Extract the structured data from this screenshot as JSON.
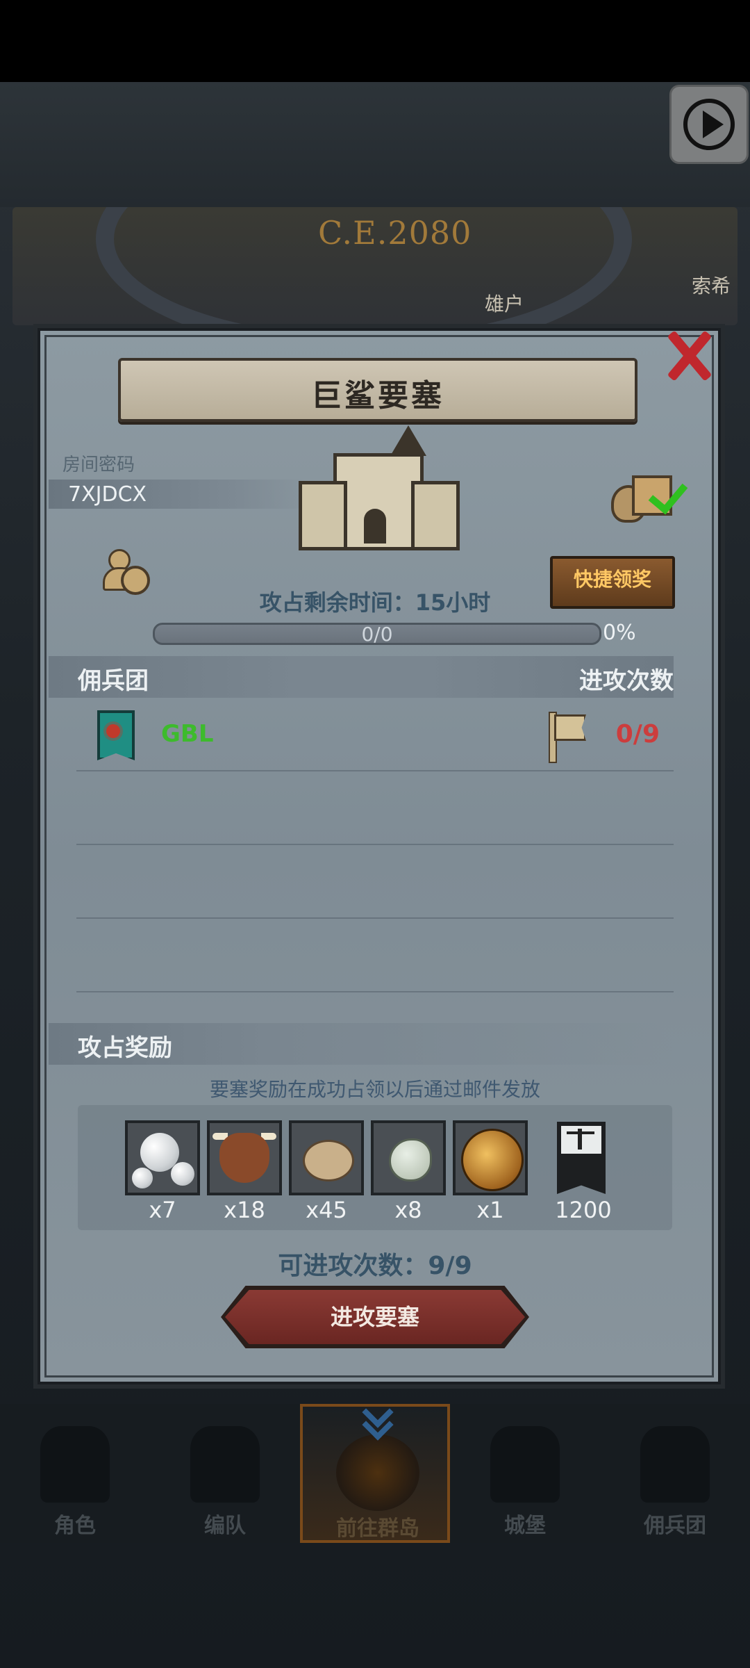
{
  "background": {
    "era_label": "C.E.2080",
    "town_label_1": "雄户",
    "town_label_2": "索希"
  },
  "dialog": {
    "title": "巨鲨要塞",
    "room_code_label": "房间密码",
    "room_code": "7XJDCX",
    "quick_claim_label": "快捷领奖",
    "timer_text": "攻占剩余时间：15小时",
    "progress": {
      "text": "0/0",
      "percent_text": "0%",
      "fraction": 0
    },
    "section_guild": "佣兵团",
    "section_attacks": "进攻次数",
    "guild": {
      "name": "GBL",
      "attacks": "0/9"
    },
    "rewards_title": "攻占奖励",
    "rewards_note": "要塞奖励在成功占领以后通过邮件发放",
    "rewards": [
      {
        "icon": "pearl-icon",
        "qty": "x7"
      },
      {
        "icon": "cow-icon",
        "qty": "x18"
      },
      {
        "icon": "sack-icon",
        "qty": "x45"
      },
      {
        "icon": "stone-icon",
        "qty": "x8"
      },
      {
        "icon": "medal-icon",
        "qty": "x1"
      },
      {
        "icon": "justice-banner-icon",
        "qty": "1200"
      }
    ],
    "remaining_attacks": "可进攻次数：9/9",
    "attack_button": "进攻要塞"
  },
  "nav": [
    {
      "label": "角色",
      "active": false
    },
    {
      "label": "编队",
      "active": false
    },
    {
      "label": "前往群岛",
      "active": true
    },
    {
      "label": "城堡",
      "active": false
    },
    {
      "label": "佣兵团",
      "active": false
    }
  ],
  "colors": {
    "guild_name": "#3dbb2c",
    "attack_count": "#cc3d3d",
    "quick_claim_text": "#ffc864",
    "close_x": "#c0272d"
  }
}
